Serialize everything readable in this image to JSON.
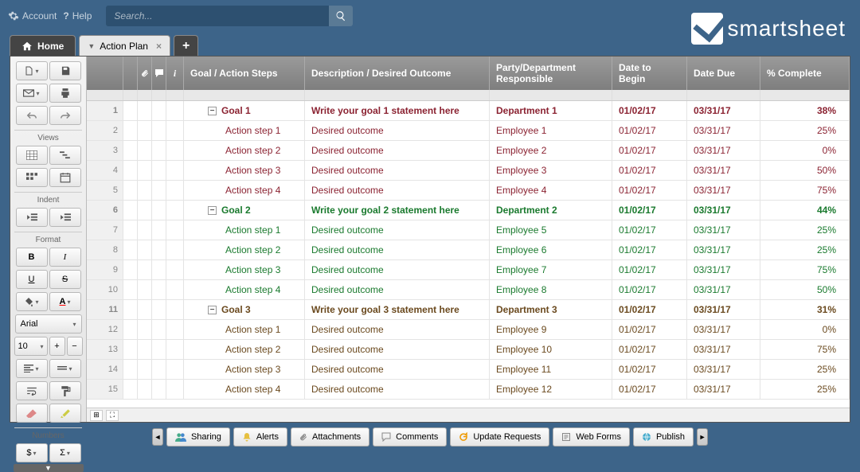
{
  "topbar": {
    "account": "Account",
    "help": "Help",
    "search_placeholder": "Search..."
  },
  "logo": "smartsheet",
  "tabs": {
    "home": "Home",
    "sheet": "Action Plan"
  },
  "sidebar": {
    "views_label": "Views",
    "indent_label": "Indent",
    "format_label": "Format",
    "numbers_label": "Numbers",
    "bold": "B",
    "italic": "I",
    "underline": "U",
    "strike": "S",
    "font": "Arial",
    "size": "10",
    "currency": "$",
    "sum": "Σ",
    "plus": "+",
    "minus": "−"
  },
  "columns": {
    "primary": "Goal / Action Steps",
    "desc": "Description / Desired Outcome",
    "party": "Party/Department Responsible",
    "begin": "Date to Begin",
    "due": "Date Due",
    "pct": "% Complete"
  },
  "rows": [
    {
      "n": "1",
      "goal": true,
      "c": 1,
      "name": "Goal 1",
      "desc": "Write your goal 1 statement here",
      "party": "Department 1",
      "begin": "01/02/17",
      "due": "03/31/17",
      "pct": "38%"
    },
    {
      "n": "2",
      "goal": false,
      "c": 1,
      "name": "Action step 1",
      "desc": "Desired outcome",
      "party": "Employee 1",
      "begin": "01/02/17",
      "due": "03/31/17",
      "pct": "25%"
    },
    {
      "n": "3",
      "goal": false,
      "c": 1,
      "name": "Action step 2",
      "desc": "Desired outcome",
      "party": "Employee 2",
      "begin": "01/02/17",
      "due": "03/31/17",
      "pct": "0%"
    },
    {
      "n": "4",
      "goal": false,
      "c": 1,
      "name": "Action step 3",
      "desc": "Desired outcome",
      "party": "Employee 3",
      "begin": "01/02/17",
      "due": "03/31/17",
      "pct": "50%"
    },
    {
      "n": "5",
      "goal": false,
      "c": 1,
      "name": "Action step 4",
      "desc": "Desired outcome",
      "party": "Employee 4",
      "begin": "01/02/17",
      "due": "03/31/17",
      "pct": "75%"
    },
    {
      "n": "6",
      "goal": true,
      "c": 2,
      "name": "Goal 2",
      "desc": "Write your goal 2 statement here",
      "party": "Department 2",
      "begin": "01/02/17",
      "due": "03/31/17",
      "pct": "44%"
    },
    {
      "n": "7",
      "goal": false,
      "c": 2,
      "name": "Action step 1",
      "desc": "Desired outcome",
      "party": "Employee 5",
      "begin": "01/02/17",
      "due": "03/31/17",
      "pct": "25%"
    },
    {
      "n": "8",
      "goal": false,
      "c": 2,
      "name": "Action step 2",
      "desc": "Desired outcome",
      "party": "Employee 6",
      "begin": "01/02/17",
      "due": "03/31/17",
      "pct": "25%"
    },
    {
      "n": "9",
      "goal": false,
      "c": 2,
      "name": "Action step 3",
      "desc": "Desired outcome",
      "party": "Employee 7",
      "begin": "01/02/17",
      "due": "03/31/17",
      "pct": "75%"
    },
    {
      "n": "10",
      "goal": false,
      "c": 2,
      "name": "Action step 4",
      "desc": "Desired outcome",
      "party": "Employee 8",
      "begin": "01/02/17",
      "due": "03/31/17",
      "pct": "50%"
    },
    {
      "n": "11",
      "goal": true,
      "c": 3,
      "name": "Goal 3",
      "desc": "Write your goal 3 statement here",
      "party": "Department 3",
      "begin": "01/02/17",
      "due": "03/31/17",
      "pct": "31%"
    },
    {
      "n": "12",
      "goal": false,
      "c": 3,
      "name": "Action step 1",
      "desc": "Desired outcome",
      "party": "Employee 9",
      "begin": "01/02/17",
      "due": "03/31/17",
      "pct": "0%"
    },
    {
      "n": "13",
      "goal": false,
      "c": 3,
      "name": "Action step 2",
      "desc": "Desired outcome",
      "party": "Employee 10",
      "begin": "01/02/17",
      "due": "03/31/17",
      "pct": "75%"
    },
    {
      "n": "14",
      "goal": false,
      "c": 3,
      "name": "Action step 3",
      "desc": "Desired outcome",
      "party": "Employee 11",
      "begin": "01/02/17",
      "due": "03/31/17",
      "pct": "25%"
    },
    {
      "n": "15",
      "goal": false,
      "c": 3,
      "name": "Action step 4",
      "desc": "Desired outcome",
      "party": "Employee 12",
      "begin": "01/02/17",
      "due": "03/31/17",
      "pct": "25%"
    }
  ],
  "bottombar": {
    "sharing": "Sharing",
    "alerts": "Alerts",
    "attachments": "Attachments",
    "comments": "Comments",
    "updates": "Update Requests",
    "webforms": "Web Forms",
    "publish": "Publish"
  },
  "col_widths": {
    "rownum": 46,
    "icon": 18,
    "primary": 152,
    "desc": 232,
    "party": 154,
    "begin": 94,
    "due": 92,
    "pct": 100
  }
}
